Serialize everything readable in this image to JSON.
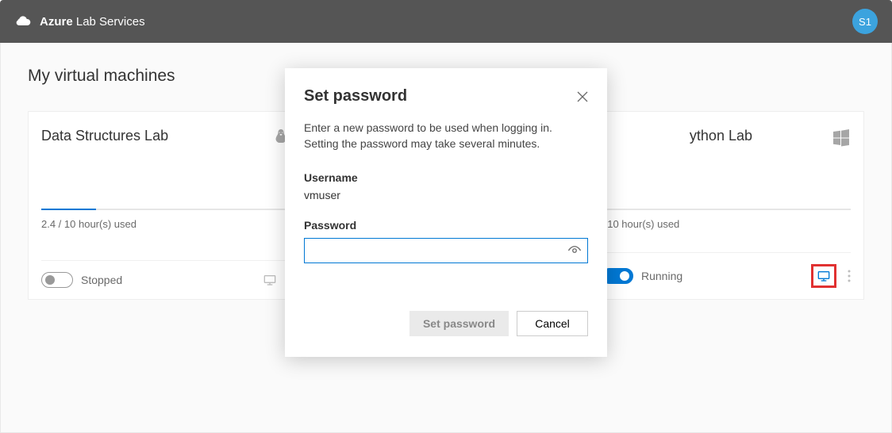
{
  "header": {
    "brand_bold": "Azure",
    "brand_light": " Lab Services",
    "avatar_initials": "S1"
  },
  "page": {
    "title": "My virtual machines"
  },
  "cards": [
    {
      "title": "Data Structures Lab",
      "os": "linux",
      "usage": "2.4 / 10 hour(s) used",
      "progress_pct": 22,
      "running": false,
      "status": "Stopped"
    },
    {
      "title": "ython Lab",
      "os": "windows",
      "usage": " / 10 hour(s) used",
      "progress_pct": 0,
      "running": true,
      "status": "Running"
    }
  ],
  "modal": {
    "title": "Set password",
    "description": "Enter a new password to be used when logging in. Setting the password may take several minutes.",
    "username_label": "Username",
    "username_value": "vmuser",
    "password_label": "Password",
    "password_value": "",
    "set_label": "Set password",
    "cancel_label": "Cancel"
  }
}
